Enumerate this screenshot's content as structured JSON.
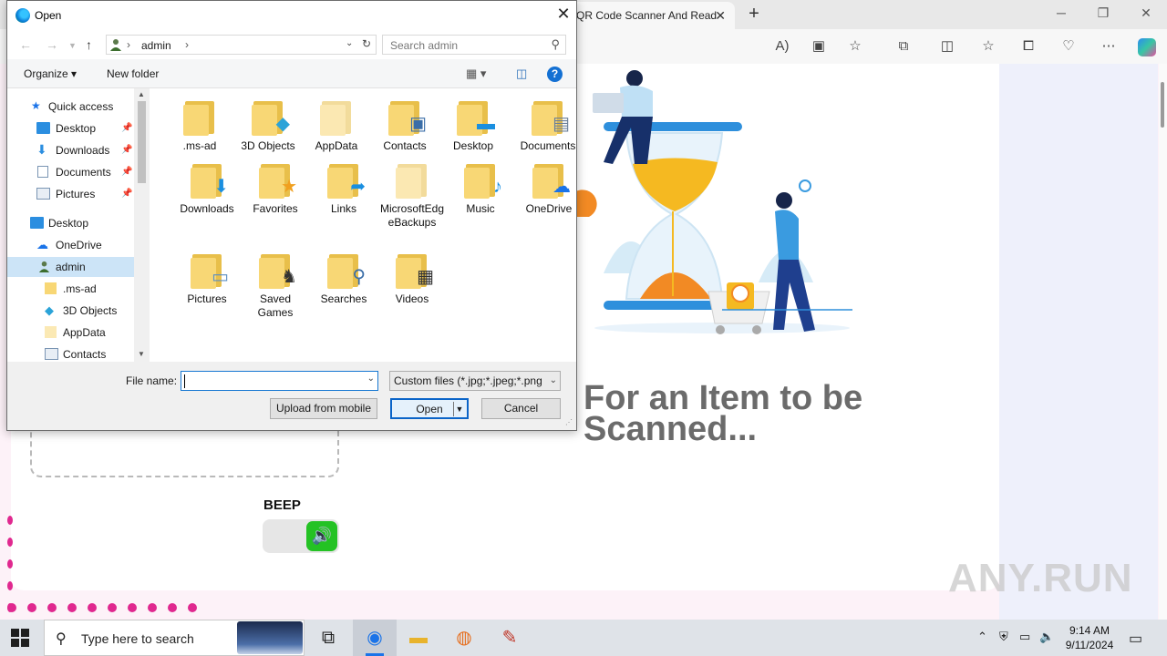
{
  "browser": {
    "tab_title": "QR Code Scanner And Read",
    "tab_close": "✕",
    "new_tab": "+",
    "win_minimize": "─",
    "win_restore": "❐",
    "win_close": "✕",
    "toolbar_icons": [
      "read-aloud-icon",
      "immersive-reader-icon",
      "favorite-star-icon",
      "extensions-icon",
      "split-screen-icon",
      "favorites-icon",
      "collections-icon",
      "performance-icon",
      "more-icon",
      "copilot-icon"
    ]
  },
  "page": {
    "status_line1": "For an Item to be",
    "status_line2": "Scanned...",
    "beep_label": "BEEP",
    "beep_icon": "speaker-icon",
    "watermark": "ANY.RUN",
    "accent_color": "#e0288f",
    "toggle_color": "#24c224"
  },
  "dialog": {
    "title": "Open",
    "close": "✕",
    "address": {
      "path_separator": "›",
      "folder": "admin",
      "trail": "›"
    },
    "search_placeholder": "Search admin",
    "organize_label": "Organize ▾",
    "new_folder_label": "New folder",
    "help_label": "?",
    "nav_items": [
      {
        "label": "Quick access",
        "icon": "star-icon",
        "pinned": false
      },
      {
        "label": "Desktop",
        "icon": "desktop-icon",
        "pinned": true
      },
      {
        "label": "Downloads",
        "icon": "download-icon",
        "pinned": true
      },
      {
        "label": "Documents",
        "icon": "document-icon",
        "pinned": true
      },
      {
        "label": "Pictures",
        "icon": "picture-icon",
        "pinned": true
      },
      {
        "label": "Desktop",
        "icon": "desktop-icon",
        "pinned": false
      },
      {
        "label": "OneDrive",
        "icon": "cloud-icon",
        "pinned": false
      },
      {
        "label": "admin",
        "icon": "user-icon",
        "pinned": false
      },
      {
        "label": ".ms-ad",
        "icon": "folder-icon",
        "pinned": false
      },
      {
        "label": "3D Objects",
        "icon": "cube-icon",
        "pinned": false
      },
      {
        "label": "AppData",
        "icon": "folder-icon",
        "pinned": false
      },
      {
        "label": "Contacts",
        "icon": "contact-card-icon",
        "pinned": false
      }
    ],
    "files": [
      {
        "label": ".ms-ad",
        "overlay": ""
      },
      {
        "label": "3D Objects",
        "overlay": "◆"
      },
      {
        "label": "AppData",
        "overlay": ""
      },
      {
        "label": "Contacts",
        "overlay": "▣"
      },
      {
        "label": "Desktop",
        "overlay": "▬"
      },
      {
        "label": "Documents",
        "overlay": "▤"
      },
      {
        "label": "Downloads",
        "overlay": "⬇"
      },
      {
        "label": "Favorites",
        "overlay": "★"
      },
      {
        "label": "Links",
        "overlay": "➦"
      },
      {
        "label": "MicrosoftEdgeBackups",
        "overlay": ""
      },
      {
        "label": "Music",
        "overlay": "♪"
      },
      {
        "label": "OneDrive",
        "overlay": "☁"
      },
      {
        "label": "Pictures",
        "overlay": "▭"
      },
      {
        "label": "Saved Games",
        "overlay": "♞"
      },
      {
        "label": "Searches",
        "overlay": "⚲"
      },
      {
        "label": "Videos",
        "overlay": "▦"
      }
    ],
    "file_name_label": "File name:",
    "file_name_value": "",
    "filter_value": "Custom files (*.jpg;*.jpeg;*.png",
    "upload_mobile_label": "Upload from mobile",
    "open_label": "Open",
    "cancel_label": "Cancel"
  },
  "taskbar": {
    "search_placeholder": "Type here to search",
    "apps": [
      "task-view-icon",
      "edge-icon",
      "file-explorer-icon",
      "firefox-icon",
      "paint-icon"
    ],
    "time": "9:14 AM",
    "date": "9/11/2024"
  }
}
